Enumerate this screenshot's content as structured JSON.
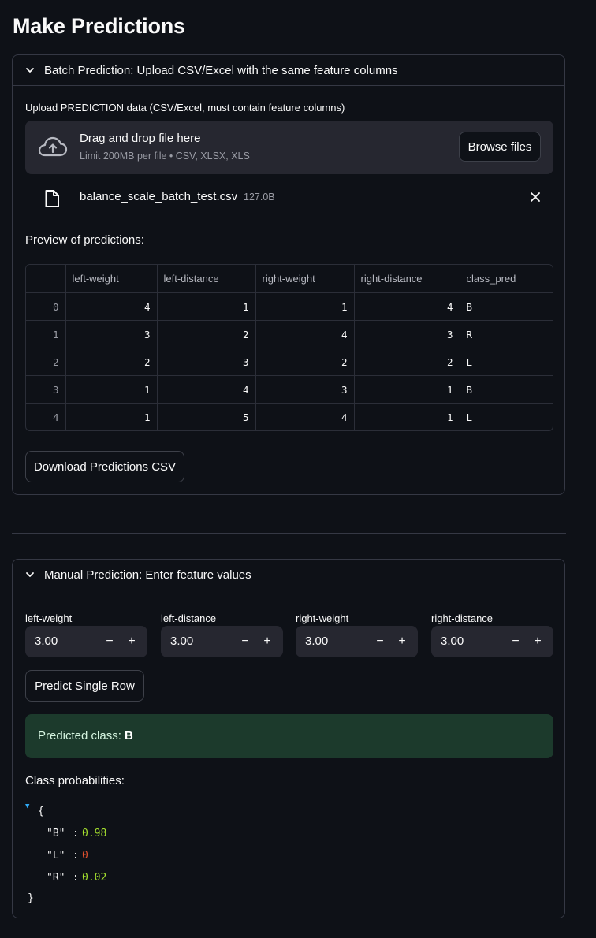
{
  "page": {
    "title": "Make Predictions"
  },
  "batch": {
    "header": "Batch Prediction: Upload CSV/Excel with the same feature columns",
    "upload_label": "Upload PREDICTION data (CSV/Excel, must contain feature columns)",
    "dropzone_title": "Drag and drop file here",
    "dropzone_sub": "Limit 200MB per file • CSV, XLSX, XLS",
    "browse_label": "Browse files",
    "file_name": "balance_scale_batch_test.csv",
    "file_size": "127.0B",
    "preview_label": "Preview of predictions:",
    "table": {
      "columns": [
        "",
        "left-weight",
        "left-distance",
        "right-weight",
        "right-distance",
        "class_pred"
      ],
      "rows": [
        [
          "0",
          "4",
          "1",
          "1",
          "4",
          "B"
        ],
        [
          "1",
          "3",
          "2",
          "4",
          "3",
          "R"
        ],
        [
          "2",
          "2",
          "3",
          "2",
          "2",
          "L"
        ],
        [
          "3",
          "1",
          "4",
          "3",
          "1",
          "B"
        ],
        [
          "4",
          "1",
          "5",
          "4",
          "1",
          "L"
        ]
      ]
    },
    "download_label": "Download Predictions CSV"
  },
  "manual": {
    "header": "Manual Prediction: Enter feature values",
    "fields": [
      {
        "label": "left-weight",
        "value": "3.00"
      },
      {
        "label": "left-distance",
        "value": "3.00"
      },
      {
        "label": "right-weight",
        "value": "3.00"
      },
      {
        "label": "right-distance",
        "value": "3.00"
      }
    ],
    "stepper_minus": "−",
    "stepper_plus": "+",
    "predict_label": "Predict Single Row",
    "result_prefix": "Predicted class: ",
    "result_class": "B",
    "probs_label": "Class probabilities:",
    "probs": [
      {
        "key": "\"B\"",
        "value": "0.98"
      },
      {
        "key": "\"L\"",
        "value": "0"
      },
      {
        "key": "\"R\"",
        "value": "0.02"
      }
    ],
    "json_open": "{",
    "json_close": "}",
    "json_sep": ":"
  },
  "colors": {
    "background": "#0e1117",
    "panel": "#262730",
    "success_bg": "#1c3a2c",
    "json_number": "#a6e22e",
    "json_zero": "#e3512f"
  }
}
